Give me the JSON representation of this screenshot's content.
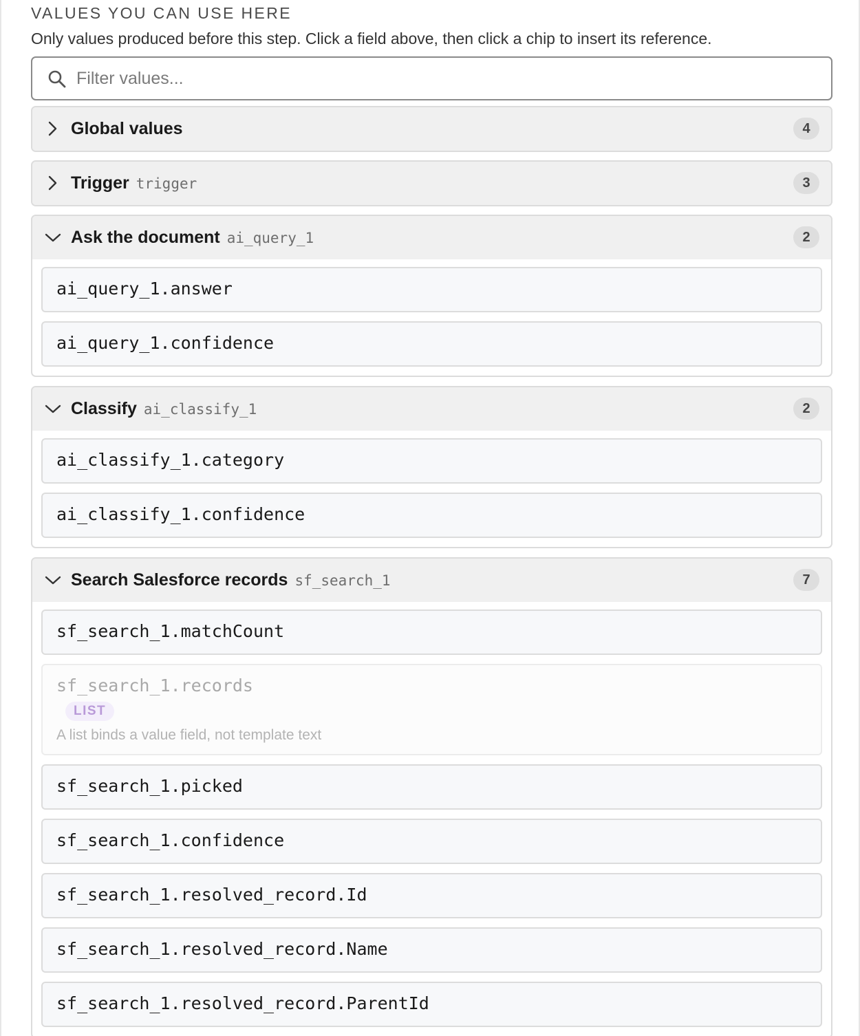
{
  "panel": {
    "heading": "VALUES YOU CAN USE HERE",
    "description": "Only values produced before this step. Click a field above, then click a chip to insert its reference.",
    "filter_placeholder": "Filter values..."
  },
  "icons": {
    "search": "search-icon",
    "collapsed": "chevron-right-icon",
    "expanded": "chevron-down-icon"
  },
  "groups": [
    {
      "title": "Global values",
      "id": "",
      "count": "4",
      "expanded": false,
      "items": []
    },
    {
      "title": "Trigger",
      "id": "trigger",
      "count": "3",
      "expanded": false,
      "items": []
    },
    {
      "title": "Ask the document",
      "id": "ai_query_1",
      "count": "2",
      "expanded": true,
      "items": [
        {
          "ref": "ai_query_1.answer"
        },
        {
          "ref": "ai_query_1.confidence"
        }
      ]
    },
    {
      "title": "Classify",
      "id": "ai_classify_1",
      "count": "2",
      "expanded": true,
      "items": [
        {
          "ref": "ai_classify_1.category"
        },
        {
          "ref": "ai_classify_1.confidence"
        }
      ]
    },
    {
      "title": "Search Salesforce records",
      "id": "sf_search_1",
      "count": "7",
      "expanded": true,
      "items": [
        {
          "ref": "sf_search_1.matchCount"
        },
        {
          "ref": "sf_search_1.records",
          "badge": "LIST",
          "note": "A list binds a value field, not template text",
          "disabled": true
        },
        {
          "ref": "sf_search_1.picked"
        },
        {
          "ref": "sf_search_1.confidence"
        },
        {
          "ref": "sf_search_1.resolved_record.Id"
        },
        {
          "ref": "sf_search_1.resolved_record.Name"
        },
        {
          "ref": "sf_search_1.resolved_record.ParentId"
        }
      ]
    }
  ]
}
